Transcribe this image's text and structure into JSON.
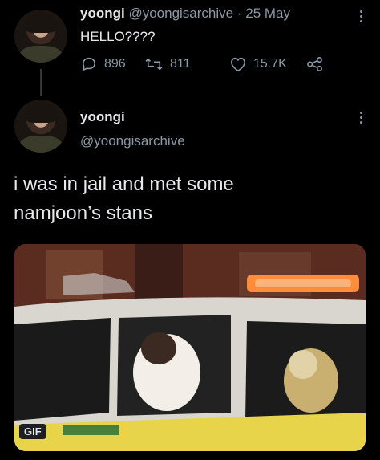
{
  "tweet1": {
    "display_name": "yoongi",
    "handle": "@yoongisarchive",
    "separator": "·",
    "date": "25 May",
    "text": "HELLO????",
    "replies": "896",
    "retweets": "811",
    "likes": "15.7K"
  },
  "tweet2": {
    "display_name": "yoongi",
    "handle": "@yoongisarchive",
    "text_line1": "i was in jail and met some",
    "text_line2": "namjoon’s stans",
    "media_badge": "GIF"
  },
  "colors": {
    "background": "#000000",
    "text_primary": "#e7e9ea",
    "text_secondary": "#8b98a5",
    "thread_line": "#333639"
  },
  "icons": [
    "reply-icon",
    "retweet-icon",
    "like-icon",
    "share-icon",
    "more-icon"
  ]
}
